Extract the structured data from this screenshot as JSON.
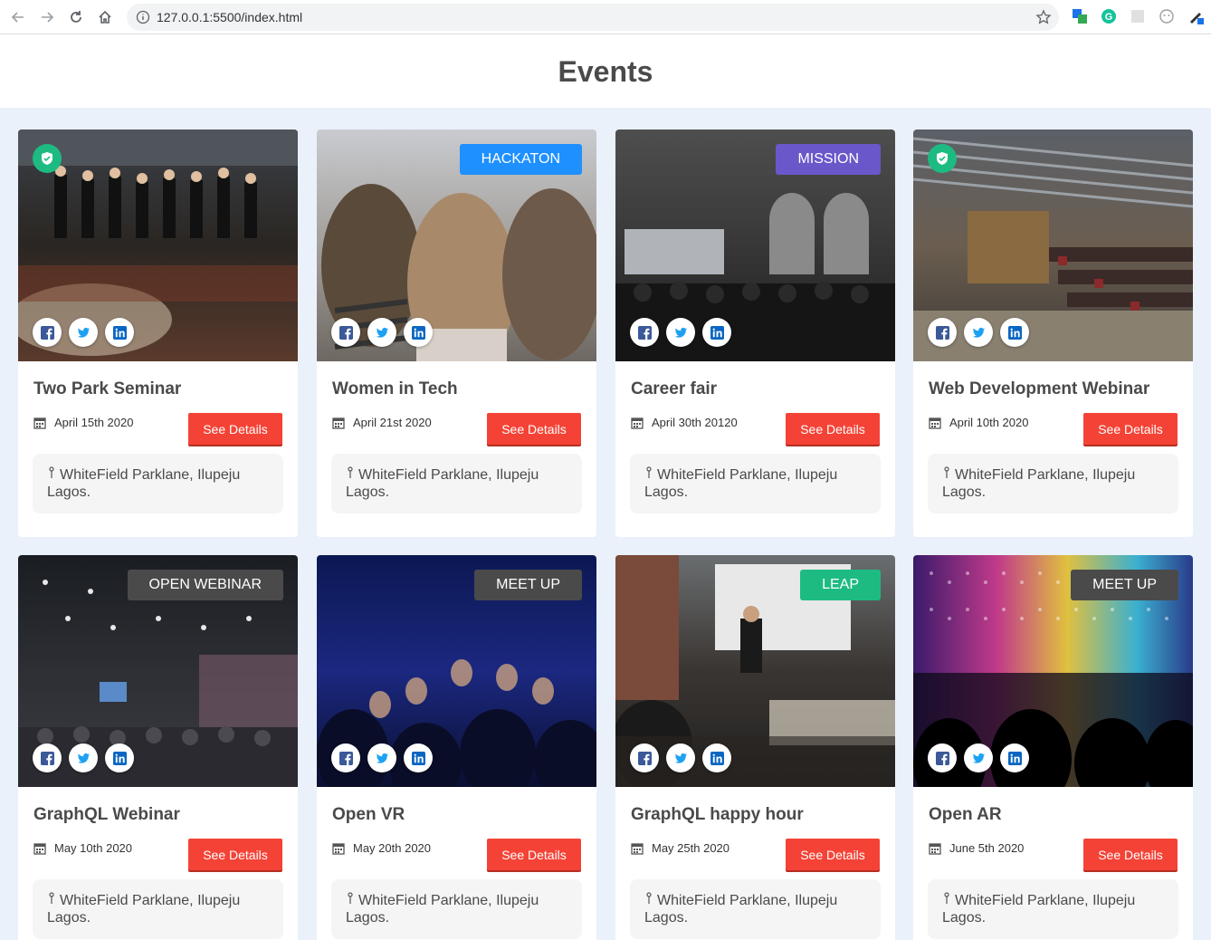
{
  "browser": {
    "url": "127.0.0.1:5500/index.html"
  },
  "page": {
    "title": "Events"
  },
  "colors": {
    "badge_blue": "#1e90ff",
    "badge_purple": "#6a57c9",
    "badge_gray": "#4a4a4a",
    "badge_green": "#1dbb82",
    "button_red": "#f44336"
  },
  "events": [
    {
      "title": "Two Park Seminar",
      "date": "April 15th 2020",
      "badge": "",
      "verified": true,
      "button": "See Details",
      "location_line1": "WhiteField Parklane, Ilupeju",
      "location_line2": "Lagos.",
      "image": "seminar-crowd-photo"
    },
    {
      "title": "Women in Tech",
      "date": "April 21st 2020",
      "badge": "HACKATON",
      "badge_color": "#1e90ff",
      "verified": false,
      "button": "See Details",
      "location_line1": "WhiteField Parklane, Ilupeju",
      "location_line2": "Lagos.",
      "image": "audience-back-photo"
    },
    {
      "title": "Career fair",
      "date": "April 30th 20120",
      "badge": "MISSION",
      "badge_color": "#6a57c9",
      "verified": false,
      "button": "See Details",
      "location_line1": "WhiteField Parklane, Ilupeju",
      "location_line2": "Lagos.",
      "image": "hall-audience-photo"
    },
    {
      "title": "Web Development Webinar",
      "date": "April 10th 2020",
      "badge": "",
      "verified": true,
      "button": "See Details",
      "location_line1": "WhiteField Parklane, Ilupeju",
      "location_line2": "Lagos.",
      "image": "lecture-hall-photo"
    },
    {
      "title": "GraphQL Webinar",
      "date": "May 10th 2020",
      "badge": "OPEN WEBINAR",
      "badge_color": "#4a4a4a",
      "verified": false,
      "button": "See Details",
      "location_line1": "WhiteField Parklane, Ilupeju",
      "location_line2": "Lagos.",
      "image": "conference-room-photo"
    },
    {
      "title": "Open VR",
      "date": "May 20th 2020",
      "badge": "MEET UP",
      "badge_color": "#4a4a4a",
      "verified": false,
      "button": "See Details",
      "location_line1": "WhiteField Parklane, Ilupeju",
      "location_line2": "Lagos.",
      "image": "cinema-audience-photo"
    },
    {
      "title": "GraphQL happy hour",
      "date": "May 25th 2020",
      "badge": "LEAP",
      "badge_color": "#1dbb82",
      "verified": false,
      "button": "See Details",
      "location_line1": "WhiteField Parklane, Ilupeju",
      "location_line2": "Lagos.",
      "image": "speaker-stage-photo"
    },
    {
      "title": "Open AR",
      "date": "June 5th 2020",
      "badge": "MEET UP",
      "badge_color": "#4a4a4a",
      "verified": false,
      "button": "See Details",
      "location_line1": "WhiteField Parklane, Ilupeju",
      "location_line2": "Lagos.",
      "image": "concert-lights-photo"
    }
  ]
}
